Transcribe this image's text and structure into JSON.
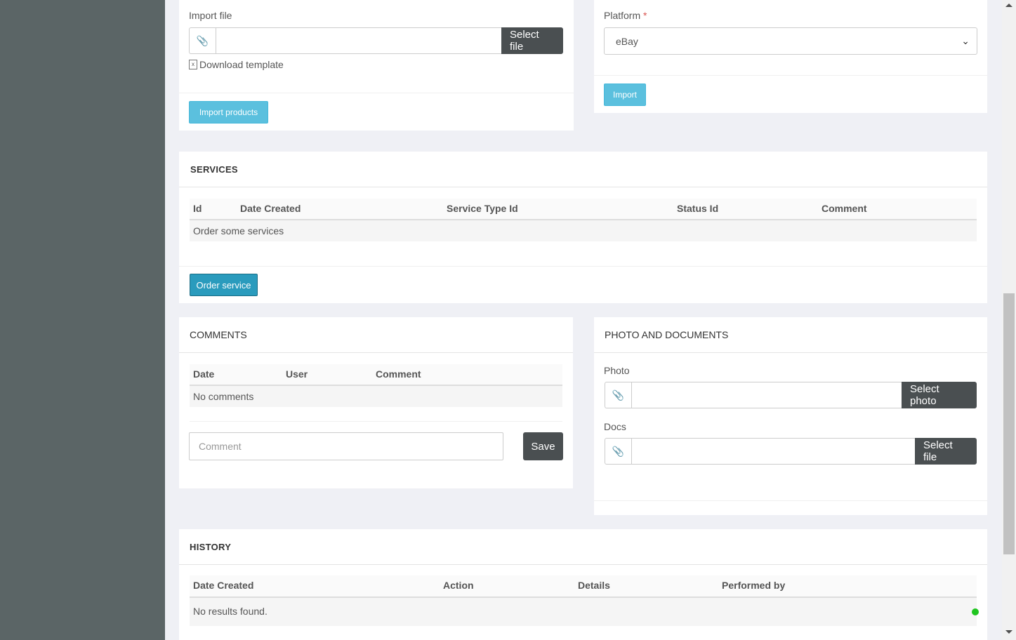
{
  "import_panel": {
    "label": "Import file",
    "select_file_label": "Select file",
    "download_template_label": "Download template",
    "import_products_label": "Import products"
  },
  "platform_panel": {
    "label": "Platform",
    "required_mark": "*",
    "selected_value": "eBay",
    "import_label": "Import"
  },
  "services": {
    "title": "SERVICES",
    "columns": [
      "Id",
      "Date Created",
      "Service Type Id",
      "Status Id",
      "Comment"
    ],
    "empty_text": "Order some services",
    "order_button_label": "Order service"
  },
  "comments": {
    "title": "COMMENTS",
    "columns": [
      "Date",
      "User",
      "Comment"
    ],
    "empty_text": "No comments",
    "input_placeholder": "Comment",
    "save_label": "Save"
  },
  "photo_docs": {
    "title": "PHOTO AND DOCUMENTS",
    "photo_label": "Photo",
    "select_photo_label": "Select photo",
    "docs_label": "Docs",
    "select_file_label": "Select file"
  },
  "history": {
    "title": "HISTORY",
    "columns": [
      "Date Created",
      "Action",
      "Details",
      "Performed by"
    ],
    "empty_text": "No results found."
  },
  "icons": {
    "paperclip": "paperclip-icon",
    "excel": "excel-file-icon",
    "chevron": "chevron-down-icon"
  },
  "colors": {
    "sidebar": "#5b6566",
    "info_button": "#5bc0de",
    "primary_button": "#2a9bbd",
    "dark_button": "#4a4f51",
    "status_dot": "#1fc51f",
    "required": "#d9534f"
  }
}
